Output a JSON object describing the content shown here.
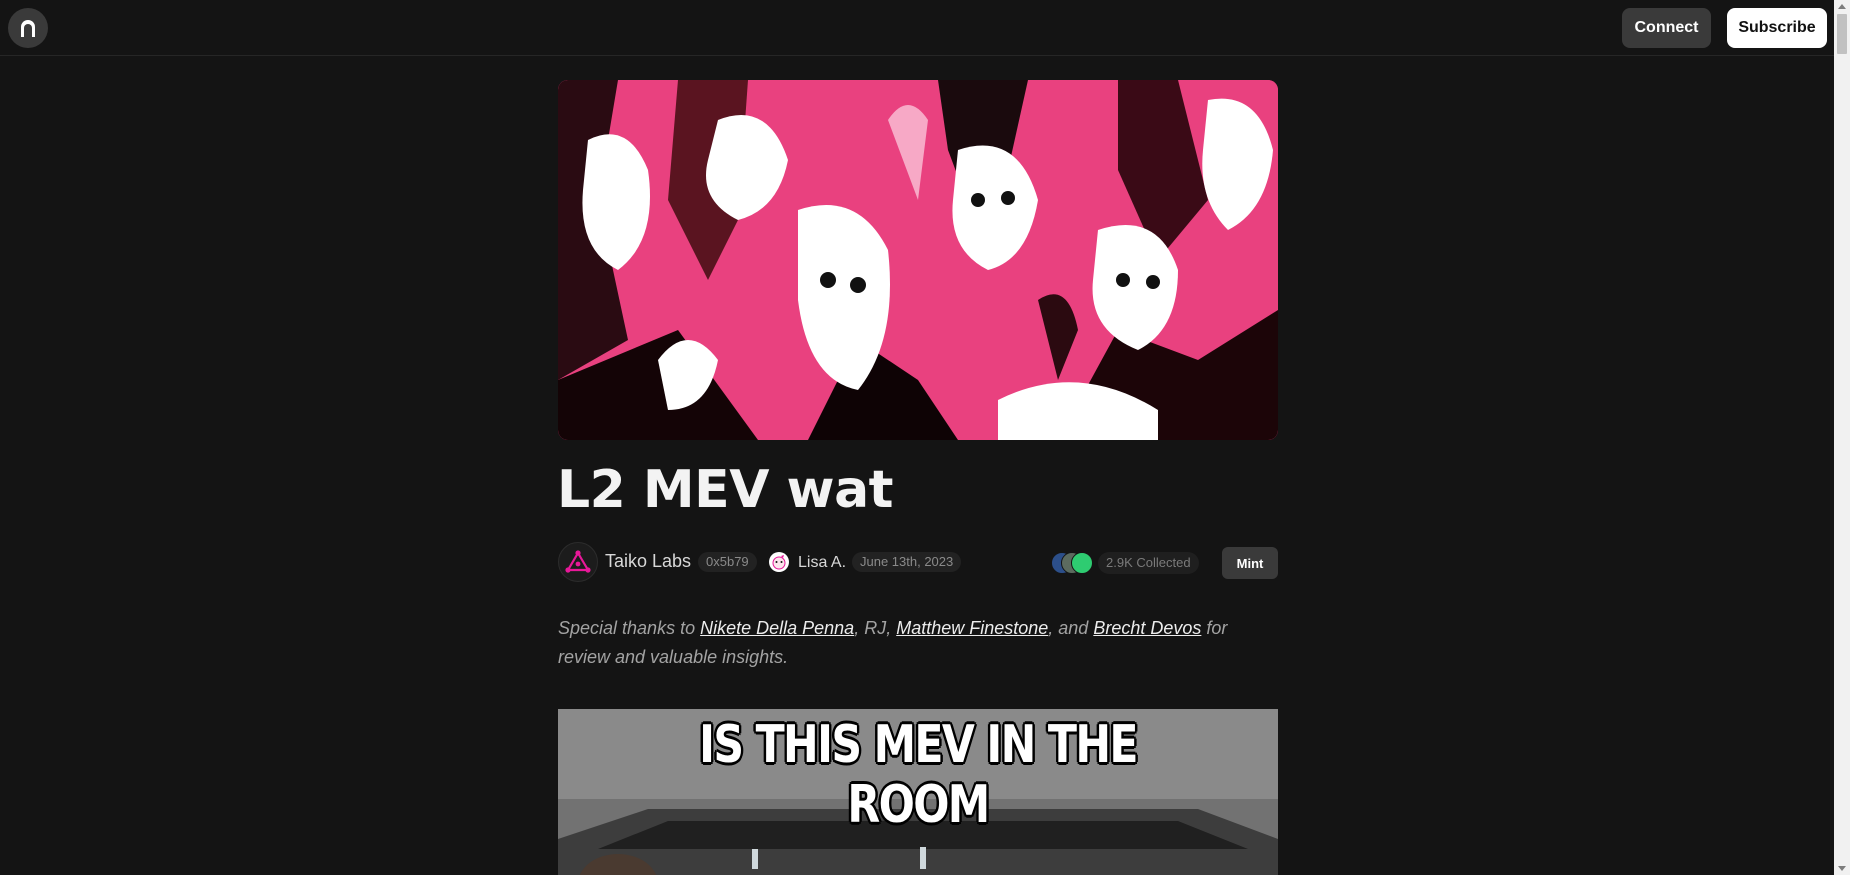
{
  "header": {
    "connect_label": "Connect",
    "subscribe_label": "Subscribe",
    "logo_icon": "arch-door-icon"
  },
  "article": {
    "title": "L2 MEV wat",
    "hero_image": "pink-cats-artwork",
    "author": {
      "name": "Taiko Labs",
      "address": "0x5b79",
      "avatar_icon": "taiko-logo-icon"
    },
    "contributor": {
      "name": "Lisa A.",
      "avatar_icon": "lisa-avatar-icon"
    },
    "date": "June 13th, 2023",
    "collected": "2.9K Collected",
    "mint_label": "Mint",
    "thanks": {
      "prefix": "Special thanks to ",
      "person1": "Nikete Della Penna",
      "sep1": ", RJ, ",
      "person2": "Matthew Finestone",
      "sep2": ", and ",
      "person3": "Brecht Devos",
      "suffix": " for review and valuable insights."
    },
    "meme_caption": "IS THIS MEV IN THE ROOM"
  },
  "colors": {
    "background": "#141414",
    "accent_pink": "#e9417f",
    "taiko_pink": "#e81899"
  }
}
